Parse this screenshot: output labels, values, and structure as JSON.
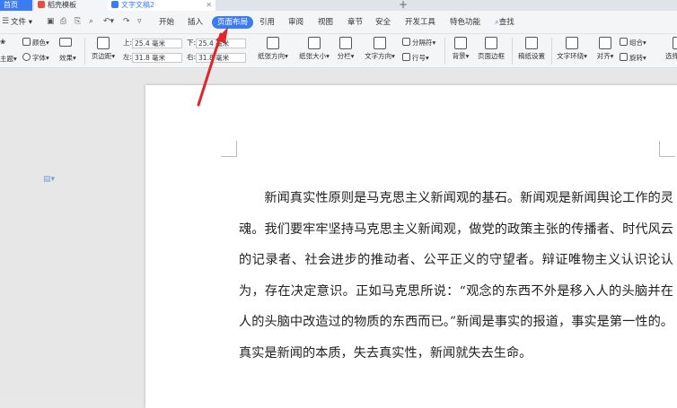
{
  "tabs": {
    "home": "首页",
    "template": "稻壳模板",
    "document": "文字文稿2"
  },
  "menu": {
    "file": "文件",
    "items": [
      "开始",
      "插入",
      "页面布局",
      "引用",
      "审阅",
      "视图",
      "章节",
      "安全",
      "开发工具",
      "特色功能"
    ],
    "active": "页面布局",
    "search": "查找"
  },
  "ribbon": {
    "theme": "主题",
    "colors": "颜色",
    "fonts": "字体",
    "effects": "效果",
    "margins": "页边距",
    "top_label": "上:",
    "top_value": "25.4 毫米",
    "bottom_label": "下:",
    "bottom_value": "25.4 毫米",
    "left_label": "左:",
    "left_value": "31.8 毫米",
    "right_label": "右:",
    "right_value": "31.8 毫米",
    "orientation": "纸张方向",
    "size": "纸张大小",
    "columns": "分栏",
    "text_direction": "文字方向",
    "breaks": "分隔符",
    "line_numbers": "行号",
    "background": "背景",
    "page_border": "页面边框",
    "manuscript": "稿纸设置",
    "text_wrap": "文字环绕",
    "align": "对齐",
    "group": "组合",
    "rotate": "旋转",
    "selection_pane": "选择窗格"
  },
  "document": {
    "paragraph": "新闻真实性原则是马克思主义新闻观的基石。新闻观是新闻舆论工作的灵魂。我们要牢牢坚持马克思主义新闻观，做党的政策主张的传播者、时代风云的记录者、社会进步的推动者、公平正义的守望者。辩证唯物主义认识论认为，存在决定意识。正如马克思所说：“观念的东西不外是移入人的头脑并在人的头脑中改造过的物质的东西而已。”新闻是事实的报道，事实是第一性的。真实是新闻的本质，失去真实性，新闻就失去生命。"
  },
  "colors": {
    "accent": "#3b7cf5",
    "arrow": "#e0262b"
  }
}
